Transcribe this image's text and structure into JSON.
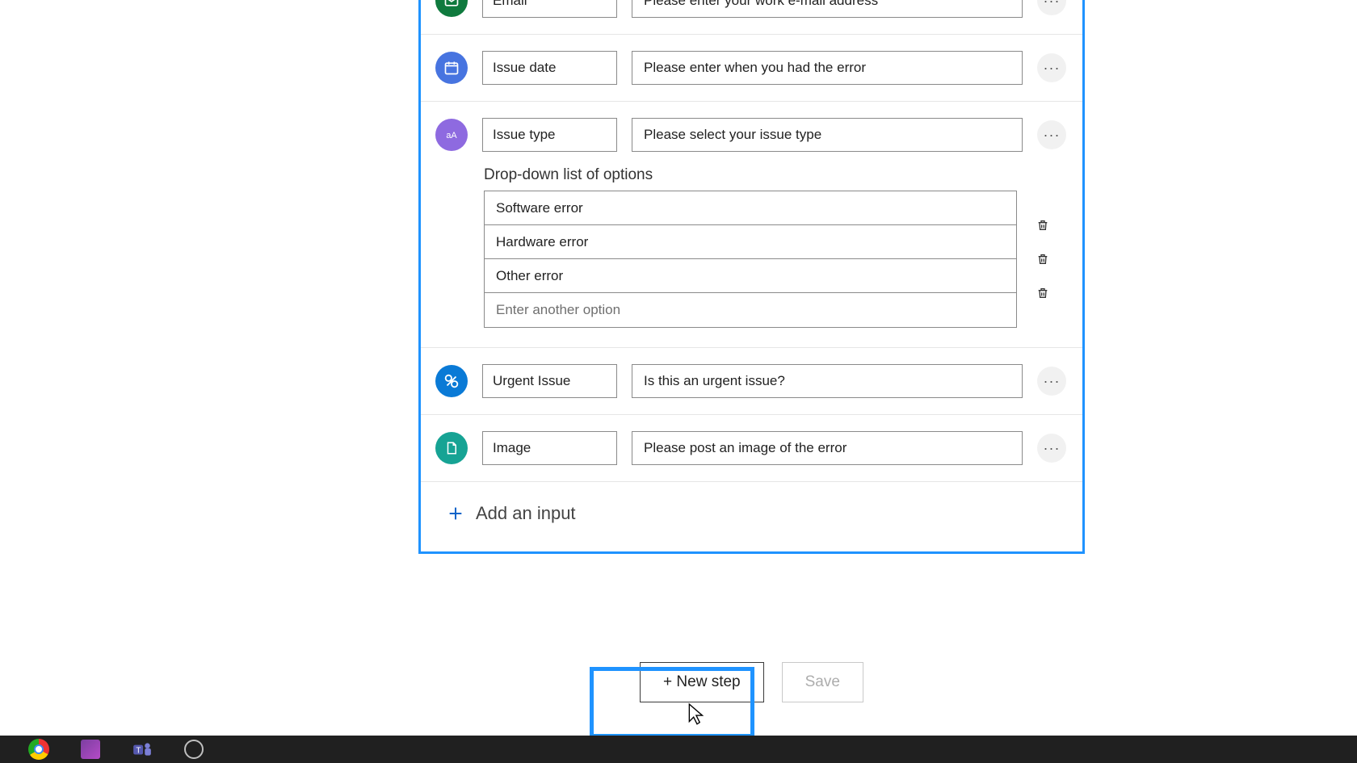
{
  "inputs": {
    "email": {
      "name": "Email",
      "desc": "Please enter your work e-mail address"
    },
    "date": {
      "name": "Issue date",
      "desc": "Please enter when you had the error"
    },
    "type": {
      "name": "Issue type",
      "desc": "Please select your issue type"
    },
    "urgent": {
      "name": "Urgent Issue",
      "desc": "Is this an urgent issue?"
    },
    "image": {
      "name": "Image",
      "desc": "Please post an image of the error"
    }
  },
  "dropdown": {
    "label": "Drop-down list of options",
    "options": [
      "Software error",
      "Hardware error",
      "Other error"
    ],
    "placeholder": "Enter another option"
  },
  "add_input_label": "Add an input",
  "actions": {
    "new_step": "+ New step",
    "save": "Save"
  }
}
